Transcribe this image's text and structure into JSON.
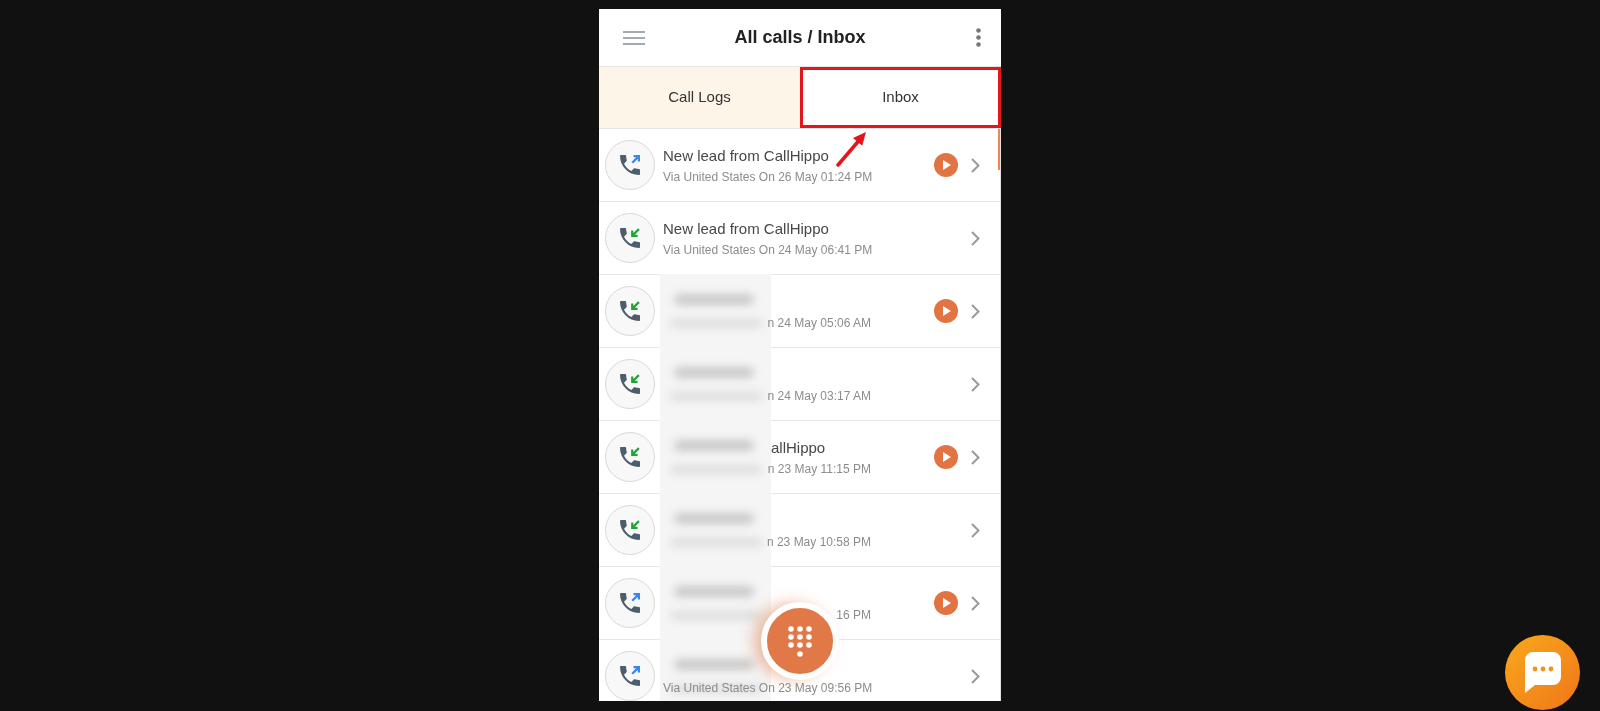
{
  "header": {
    "title": "All calls / Inbox"
  },
  "tabs": [
    {
      "label": "Call Logs",
      "selected": false,
      "highlighted": false
    },
    {
      "label": "Inbox",
      "selected": true,
      "highlighted": true
    }
  ],
  "calls": [
    {
      "kind": "outgoing",
      "title": "New lead from CallHippo",
      "details": "Via United States On 26 May 01:24 PM",
      "recording": true,
      "redacted": false
    },
    {
      "kind": "incoming",
      "title": "New lead from CallHippo",
      "details": "Via United States On 24 May 06:41 PM",
      "recording": false,
      "redacted": false
    },
    {
      "kind": "incoming",
      "details": "n 24 May 05:06 AM",
      "recording": true,
      "redacted": true
    },
    {
      "kind": "incoming",
      "details": "n 24 May 03:17 AM",
      "recording": false,
      "redacted": true
    },
    {
      "kind": "incoming",
      "title": "allHippo",
      "details": "n 23 May 11:15 PM",
      "recording": true,
      "redacted": true
    },
    {
      "kind": "incoming",
      "details": "n 23 May 10:58 PM",
      "recording": false,
      "redacted": true
    },
    {
      "kind": "outgoing",
      "details": "16 PM",
      "recording": true,
      "redacted": true
    },
    {
      "kind": "outgoing",
      "details": "Via United States On 23 May 09:56 PM",
      "recording": false,
      "redacted": true
    }
  ]
}
